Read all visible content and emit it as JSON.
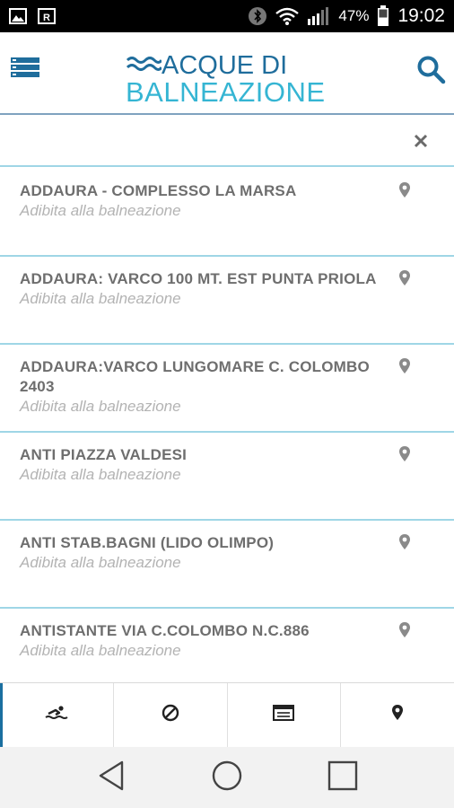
{
  "status_bar": {
    "battery_percent": "47%",
    "time": "19:02",
    "icons": [
      "gallery-icon",
      "app-notification-icon",
      "bluetooth-icon",
      "wifi-icon",
      "signal-icon",
      "battery-icon"
    ]
  },
  "header": {
    "logo_line1": "ACQUE DI",
    "logo_line2": "BALNEAZIONE",
    "menu_icon": "menu-icon",
    "search_icon": "search-icon"
  },
  "search": {
    "value": "",
    "placeholder": "",
    "clear_icon": "close-icon"
  },
  "list": {
    "items": [
      {
        "title": "ADDAURA - COMPLESSO LA MARSA",
        "subtitle": "Adibita alla balneazione"
      },
      {
        "title": "ADDAURA: VARCO 100 MT. EST PUNTA PRIOLA",
        "subtitle": "Adibita alla balneazione"
      },
      {
        "title": "ADDAURA:VARCO LUNGOMARE C. COLOMBO 2403",
        "subtitle": "Adibita alla balneazione"
      },
      {
        "title": "ANTI PIAZZA VALDESI",
        "subtitle": "Adibita alla balneazione"
      },
      {
        "title": "ANTI STAB.BAGNI (LIDO OLIMPO)",
        "subtitle": "Adibita alla balneazione"
      },
      {
        "title": "ANTISTANTE VIA C.COLOMBO N.C.886",
        "subtitle": "Adibita alla balneazione"
      }
    ]
  },
  "tabs": [
    {
      "icon": "swimmer-icon",
      "active": true
    },
    {
      "icon": "prohibited-icon",
      "active": false
    },
    {
      "icon": "list-card-icon",
      "active": false
    },
    {
      "icon": "map-pin-icon",
      "active": false
    }
  ],
  "nav": {
    "icons": [
      "back-icon",
      "home-icon",
      "recents-icon"
    ]
  },
  "colors": {
    "brand_dark": "#1f6d9c",
    "brand_light": "#35b5d3",
    "divider": "#9fd6e6",
    "title_text": "#6e6e6e",
    "subtitle_text": "#b3b3b3"
  }
}
